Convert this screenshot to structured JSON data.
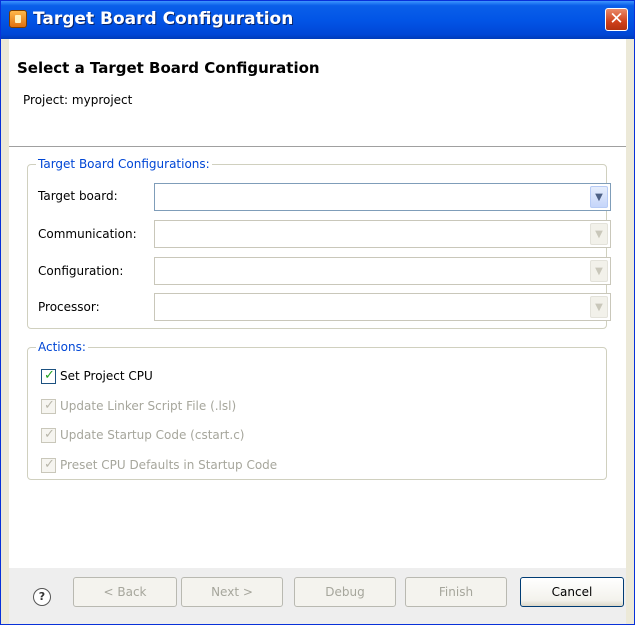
{
  "window": {
    "title": "Target Board Configuration",
    "close_glyph": "✕"
  },
  "header": {
    "title": "Select a Target Board Configuration",
    "description": "Project: myproject"
  },
  "board_group": {
    "legend": "Target Board Configurations:",
    "fields": [
      {
        "label": "Target board:",
        "value": "",
        "enabled": true
      },
      {
        "label": "Communication:",
        "value": "",
        "enabled": false
      },
      {
        "label": "Configuration:",
        "value": "",
        "enabled": false
      },
      {
        "label": "Processor:",
        "value": "",
        "enabled": false
      }
    ]
  },
  "actions_group": {
    "legend": "Actions:",
    "checks": [
      {
        "label": "Set Project CPU",
        "checked": true,
        "enabled": true
      },
      {
        "label": "Update Linker Script File (.lsl)",
        "checked": true,
        "enabled": false
      },
      {
        "label": "Update Startup Code (cstart.c)",
        "checked": true,
        "enabled": false
      },
      {
        "label": "Preset CPU Defaults in Startup Code",
        "checked": true,
        "enabled": false
      }
    ]
  },
  "footer": {
    "help_glyph": "?",
    "back_label": "< Back",
    "next_label": "Next >",
    "debug_label": "Debug",
    "finish_label": "Finish",
    "cancel_label": "Cancel"
  },
  "glyphs": {
    "dropdown": "▼",
    "check": "✓"
  },
  "icons": {
    "app": "app-icon",
    "close": "close-icon",
    "help": "help-icon"
  },
  "colors": {
    "title_bar": "#0255e6",
    "legend_text": "#0046d5",
    "check_mark": "#21a121"
  }
}
